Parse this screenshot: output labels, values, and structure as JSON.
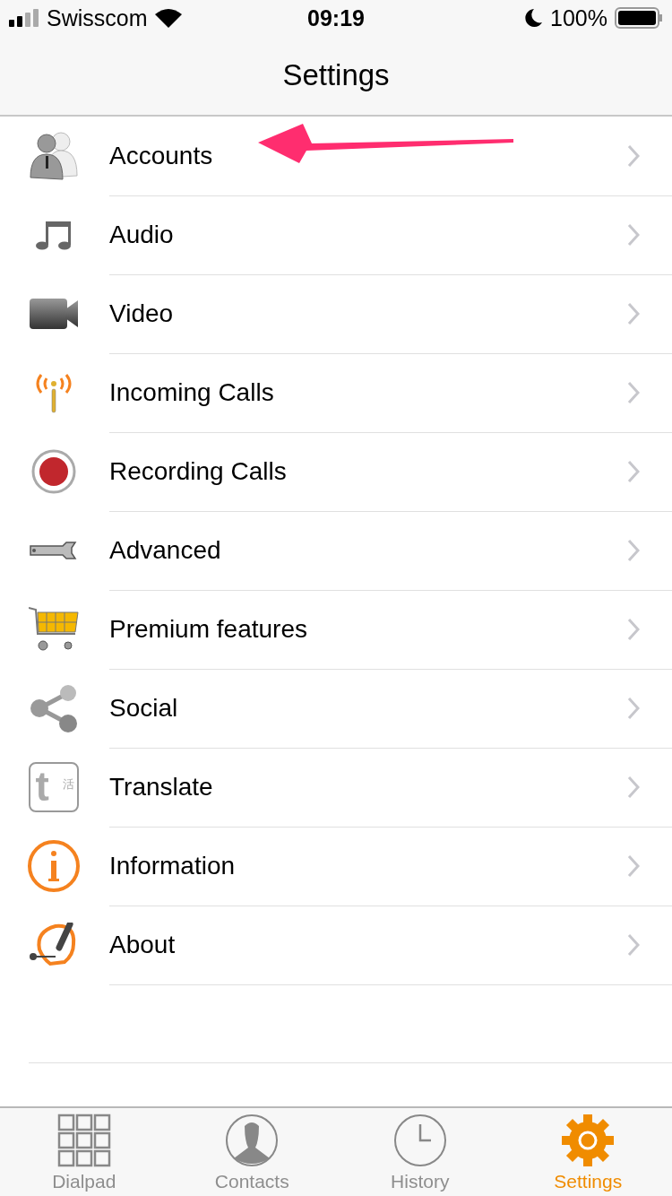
{
  "status_bar": {
    "carrier": "Swisscom",
    "time": "09:19",
    "battery": "100%"
  },
  "nav_bar": {
    "title": "Settings"
  },
  "items": [
    {
      "kind": "accounts",
      "label": "Accounts",
      "highlighted": true
    },
    {
      "kind": "audio",
      "label": "Audio",
      "highlighted": false
    },
    {
      "kind": "video",
      "label": "Video",
      "highlighted": false
    },
    {
      "kind": "incoming",
      "label": "Incoming Calls",
      "highlighted": false
    },
    {
      "kind": "recording",
      "label": "Recording Calls",
      "highlighted": false
    },
    {
      "kind": "advanced",
      "label": "Advanced",
      "highlighted": false
    },
    {
      "kind": "cart",
      "label": "Premium features",
      "highlighted": false
    },
    {
      "kind": "social",
      "label": "Social",
      "highlighted": false
    },
    {
      "kind": "translate",
      "label": "Translate",
      "highlighted": false,
      "icon_text": "t",
      "icon_subtext": "活"
    },
    {
      "kind": "info",
      "label": "Information",
      "highlighted": false
    },
    {
      "kind": "about",
      "label": "About",
      "highlighted": false
    }
  ],
  "tabs": [
    {
      "kind": "dialpad",
      "label": "Dialpad",
      "selected": false
    },
    {
      "kind": "contacts",
      "label": "Contacts",
      "selected": false
    },
    {
      "kind": "history",
      "label": "History",
      "selected": false
    },
    {
      "kind": "settings",
      "label": "Settings",
      "selected": true
    }
  ]
}
